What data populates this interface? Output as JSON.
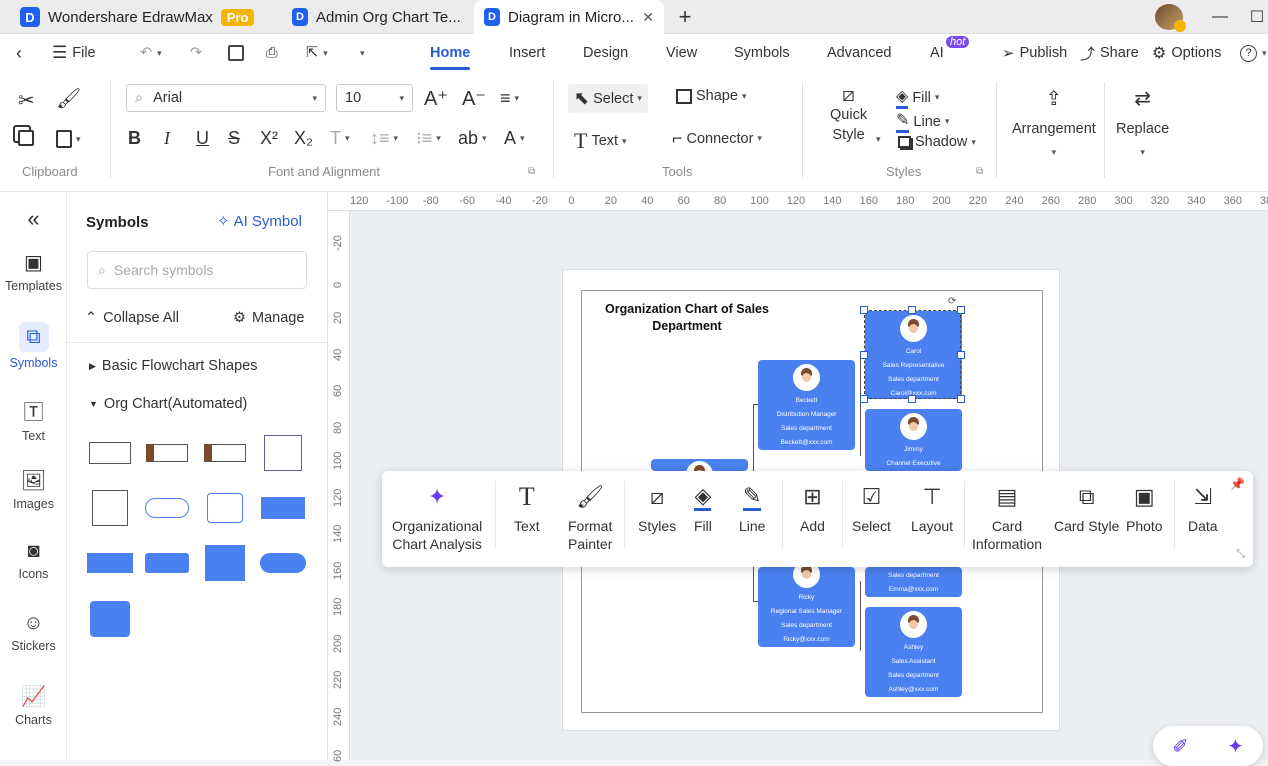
{
  "tabs": [
    {
      "label": "Wondershare EdrawMax",
      "badge": "Pro"
    },
    {
      "label": "Admin Org Chart Te..."
    },
    {
      "label": "Diagram in Micro..."
    }
  ],
  "menu": {
    "file": "File",
    "items": [
      "Home",
      "Insert",
      "Design",
      "View",
      "Symbols",
      "Advanced",
      "AI"
    ],
    "ai_badge": "hot",
    "publish": "Publish",
    "share": "Share",
    "options": "Options"
  },
  "ribbon": {
    "font_name": "Arial",
    "font_size": "10",
    "groups": {
      "clipboard": "Clipboard",
      "font": "Font and Alignment",
      "tools": "Tools",
      "styles": "Styles"
    },
    "select": "Select",
    "shape": "Shape",
    "text": "Text",
    "connector": "Connector",
    "quick_style_1": "Quick",
    "quick_style_2": "Style",
    "fill": "Fill",
    "line": "Line",
    "shadow": "Shadow",
    "arrangement": "Arrangement",
    "replace": "Replace",
    "ab": "ab"
  },
  "rail": [
    "Templates",
    "Symbols",
    "Text",
    "Images",
    "Icons",
    "Stickers",
    "Charts"
  ],
  "panel": {
    "title": "Symbols",
    "ai_symbol": "AI Symbol",
    "search_placeholder": "Search symbols",
    "collapse": "Collapse All",
    "manage": "Manage",
    "sections": [
      "Basic Flowchart Shapes",
      "Org Chart(Automated)"
    ]
  },
  "ruler_top": [
    "120",
    "-100",
    "-80",
    "-60",
    "-40",
    "-20",
    "0",
    "20",
    "40",
    "60",
    "80",
    "100",
    "120",
    "140",
    "160",
    "180",
    "200",
    "220",
    "240",
    "260",
    "280",
    "300",
    "320",
    "340",
    "360",
    "38"
  ],
  "ruler_left": [
    "-20",
    "0",
    "20",
    "40",
    "60",
    "80",
    "100",
    "120",
    "140",
    "160",
    "180",
    "200",
    "220",
    "240",
    "60"
  ],
  "chart": {
    "title": "Organization Chart of Sales Department",
    "cards": [
      {
        "name": "Carol",
        "role": "Sales Representative",
        "dept": "Sales department",
        "email": "Carol@xxx.com"
      },
      {
        "name": "Beckett",
        "role": "Distribution Manager",
        "dept": "Sales department",
        "email": "Beckett@xxx.com"
      },
      {
        "name": "Jimmy",
        "role": "Channel Executive",
        "dept": "",
        "email": ""
      },
      {
        "name": "Ricky",
        "role": "Regional Sales Manager",
        "dept": "Sales department",
        "email": "Ricky@xxx.com"
      },
      {
        "name": "",
        "role": "",
        "dept": "Sales department",
        "email": "Emma@xxx.com"
      },
      {
        "name": "Ashley",
        "role": "Sales Assistant",
        "dept": "Sales department",
        "email": "Ashley@xxx.com"
      }
    ]
  },
  "floating_toolbar": {
    "analysis_1": "Organizational",
    "analysis_2": "Chart Analysis",
    "text": "Text",
    "format_1": "Format",
    "format_2": "Painter",
    "styles": "Styles",
    "fill": "Fill",
    "line": "Line",
    "add": "Add",
    "select": "Select",
    "layout": "Layout",
    "card_info_1": "Card",
    "card_info_2": "Information",
    "card_style": "Card Style",
    "photo": "Photo",
    "data": "Data"
  }
}
